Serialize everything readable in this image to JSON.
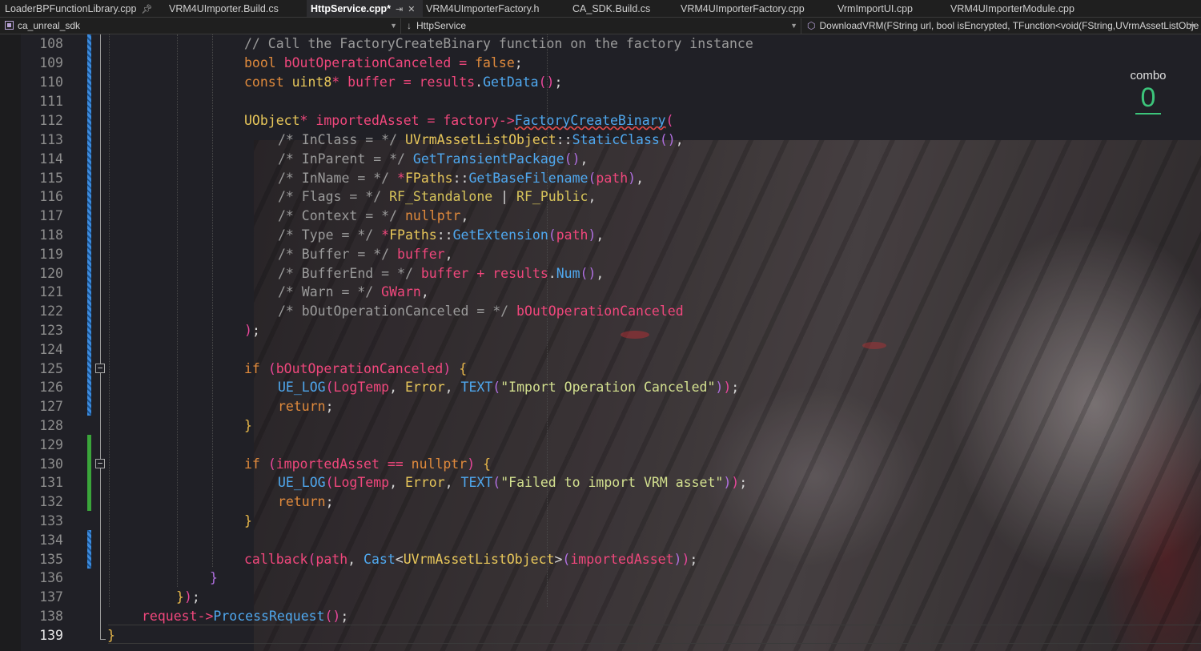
{
  "tabs": [
    {
      "label": "LoaderBPFunctionLibrary.cpp",
      "pinned": true
    },
    {
      "label": "VRM4UImporter.Build.cs"
    },
    {
      "label": "HttpService.cpp*",
      "active": true,
      "pinned": true
    },
    {
      "label": "VRM4UImporterFactory.h"
    },
    {
      "label": "CA_SDK.Build.cs"
    },
    {
      "label": "VRM4UImporterFactory.cpp"
    },
    {
      "label": "VrmImportUI.cpp"
    },
    {
      "label": "VRM4UImporterModule.cpp"
    }
  ],
  "nav": {
    "project": "ca_unreal_sdk",
    "scope": "HttpService",
    "member": "DownloadVRM(FString url, bool isEncrypted, TFunction<void(FString,UVrmAssetListObje"
  },
  "combo": {
    "label": "combo",
    "value": "0"
  },
  "line_numbers": [
    "108",
    "109",
    "110",
    "111",
    "112",
    "113",
    "114",
    "115",
    "116",
    "117",
    "118",
    "119",
    "120",
    "121",
    "122",
    "123",
    "124",
    "125",
    "126",
    "127",
    "128",
    "129",
    "130",
    "131",
    "132",
    "133",
    "134",
    "135",
    "136",
    "137",
    "138",
    "139"
  ],
  "code": {
    "l108": {
      "comment": "// Call the FactoryCreateBinary function on the factory instance"
    },
    "l109": {
      "kw": "bool",
      "id": "bOutOperationCanceled",
      "eq": "=",
      "val": "false",
      "semi": ";"
    },
    "l110": {
      "kw": "const",
      "ty": "uint8",
      "star": "*",
      "id": "buffer",
      "eq": "=",
      "obj": "results",
      "dot": ".",
      "fn": "GetData",
      "call": "()",
      "semi": ";"
    },
    "l112": {
      "ty": "UObject",
      "star": "*",
      "id": "importedAsset",
      "eq": "=",
      "obj": "factory",
      "arrow": "->",
      "fn": "FactoryCreateBinary",
      "open": "("
    },
    "l113": {
      "comment": "/* InClass = */",
      "ty": "UVrmAssetListObject",
      "sep": "::",
      "fn": "StaticClass",
      "call": "()",
      "comma": ","
    },
    "l114": {
      "comment": "/* InParent = */",
      "fn": "GetTransientPackage",
      "call": "()",
      "comma": ","
    },
    "l115": {
      "comment": "/* InName = */",
      "star": "*",
      "ty": "FPaths",
      "sep": "::",
      "fn": "GetBaseFilename",
      "open": "(",
      "arg": "path",
      "close": ")",
      "comma": ","
    },
    "l116": {
      "comment": "/* Flags = */",
      "c1": "RF_Standalone",
      "pipe": "|",
      "c2": "RF_Public",
      "comma": ","
    },
    "l117": {
      "comment": "/* Context = */",
      "val": "nullptr",
      "comma": ","
    },
    "l118": {
      "comment": "/* Type = */",
      "star": "*",
      "ty": "FPaths",
      "sep": "::",
      "fn": "GetExtension",
      "open": "(",
      "arg": "path",
      "close": ")",
      "comma": ","
    },
    "l119": {
      "comment": "/* Buffer = */",
      "id": "buffer",
      "comma": ","
    },
    "l120": {
      "comment": "/* BufferEnd = */",
      "id": "buffer",
      "plus": "+",
      "obj": "results",
      "dot": ".",
      "fn": "Num",
      "call": "()",
      "comma": ","
    },
    "l121": {
      "comment": "/* Warn = */",
      "id": "GWarn",
      "comma": ","
    },
    "l122": {
      "comment": "/* bOutOperationCanceled = */",
      "id": "bOutOperationCanceled"
    },
    "l123": {
      "close": ")",
      "semi": ";"
    },
    "l125": {
      "kw": "if",
      "open": "(",
      "id": "bOutOperationCanceled",
      "close": ")",
      "brace": "{"
    },
    "l126": {
      "macro": "UE_LOG",
      "open": "(",
      "cat": "LogTemp",
      "comma1": ",",
      "verb": "Error",
      "comma2": ",",
      "text": "TEXT",
      "open2": "(",
      "str": "\"Import Operation Canceled\"",
      "close2": ")",
      "close": ")",
      "semi": ";"
    },
    "l127": {
      "kw": "return",
      "semi": ";"
    },
    "l128": {
      "brace": "}"
    },
    "l130": {
      "kw": "if",
      "open": "(",
      "id": "importedAsset",
      "op": "==",
      "val": "nullptr",
      "close": ")",
      "brace": "{"
    },
    "l131": {
      "macro": "UE_LOG",
      "open": "(",
      "cat": "LogTemp",
      "comma1": ",",
      "verb": "Error",
      "comma2": ",",
      "text": "TEXT",
      "open2": "(",
      "str": "\"Failed to import VRM asset\"",
      "close2": ")",
      "close": ")",
      "semi": ";"
    },
    "l132": {
      "kw": "return",
      "semi": ";"
    },
    "l133": {
      "brace": "}"
    },
    "l135": {
      "id": "callback",
      "open": "(",
      "arg": "path",
      "comma": ",",
      "fn": "Cast",
      "lt": "<",
      "ty": "UVrmAssetListObject",
      "gt": ">",
      "open2": "(",
      "arg2": "importedAsset",
      "close2": ")",
      "close": ")",
      "semi": ";"
    },
    "l136": {
      "brace": "}"
    },
    "l137": {
      "brace": "}",
      "close": ")",
      "semi": ";"
    },
    "l138": {
      "obj": "request",
      "arrow": "->",
      "fn": "ProcessRequest",
      "call": "()",
      "semi": ";"
    },
    "l139": {
      "brace": "}"
    }
  },
  "colors": {
    "keyword": "#e08a3c",
    "type": "#e8c75a",
    "identifier": "#f0477c",
    "function": "#4fa8ef",
    "string": "#d3e08f",
    "comment": "#9b9b9b",
    "combo": "#3cc47a"
  }
}
